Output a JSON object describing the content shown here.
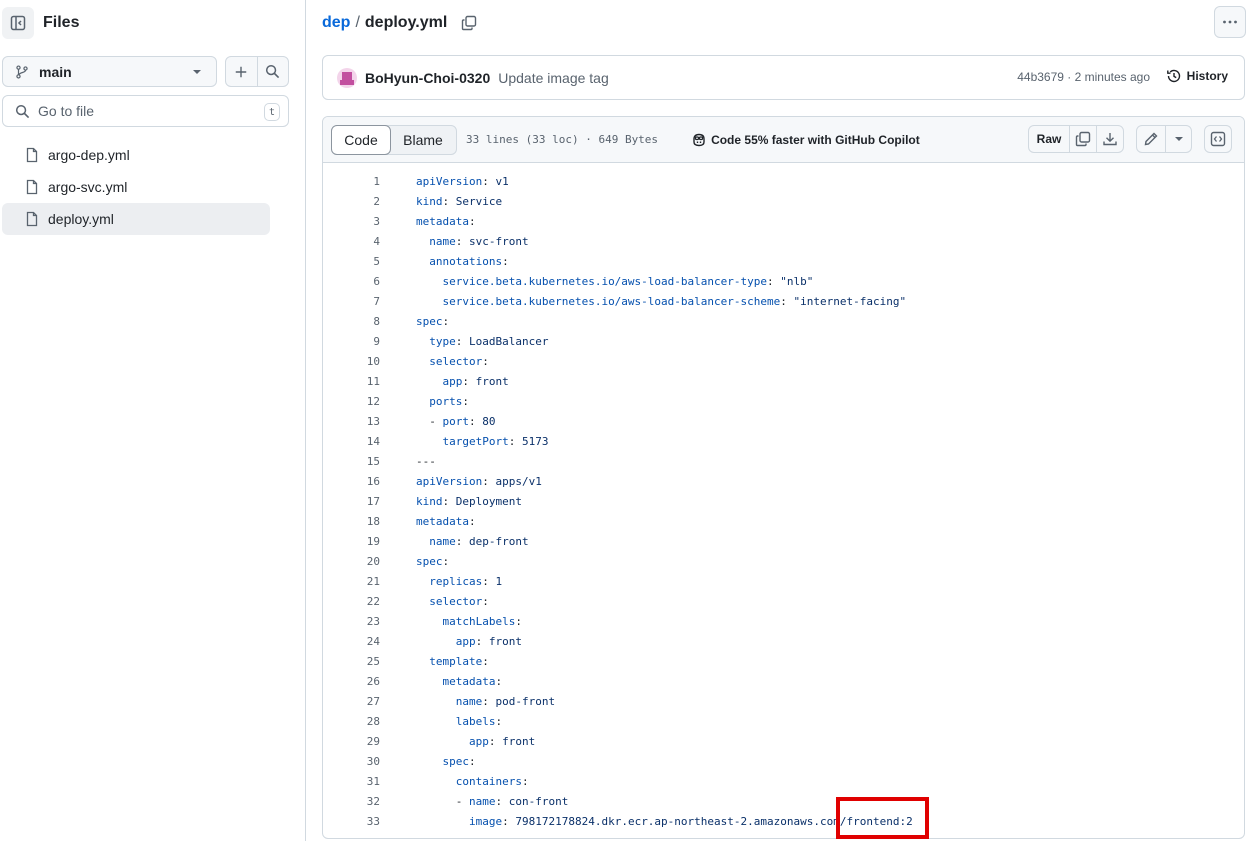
{
  "sidebar": {
    "title": "Files",
    "branch": "main",
    "search_placeholder": "Go to file",
    "search_shortcut": "t",
    "files": [
      {
        "name": "argo-dep.yml",
        "active": false
      },
      {
        "name": "argo-svc.yml",
        "active": false
      },
      {
        "name": "deploy.yml",
        "active": true
      }
    ]
  },
  "breadcrumb": {
    "repo": "dep",
    "separator": "/",
    "file": "deploy.yml"
  },
  "commit": {
    "author": "BoHyun-Choi-0320",
    "message": "Update image tag",
    "meta": "44b3679 · 2 minutes ago",
    "history_label": "History"
  },
  "file_header": {
    "code_tab": "Code",
    "blame_tab": "Blame",
    "info": "33 lines (33 loc) · 649 Bytes",
    "copilot": "Code 55% faster with GitHub Copilot",
    "raw_label": "Raw"
  },
  "code_lines": [
    {
      "n": "1",
      "key": "apiVersion",
      "val": "v1"
    },
    {
      "n": "2",
      "key": "kind",
      "val": "Service"
    },
    {
      "n": "3",
      "key": "metadata",
      "val": ""
    },
    {
      "n": "4",
      "key": "  name",
      "val": "svc-front"
    },
    {
      "n": "5",
      "key": "  annotations",
      "val": ""
    },
    {
      "n": "6",
      "key": "    service.beta.kubernetes.io/aws-load-balancer-type",
      "val": "\"nlb\""
    },
    {
      "n": "7",
      "key": "    service.beta.kubernetes.io/aws-load-balancer-scheme",
      "val": "\"internet-facing\""
    },
    {
      "n": "8",
      "key": "spec",
      "val": ""
    },
    {
      "n": "9",
      "key": "  type",
      "val": "LoadBalancer"
    },
    {
      "n": "10",
      "key": "  selector",
      "val": ""
    },
    {
      "n": "11",
      "key": "    app",
      "val": "front"
    },
    {
      "n": "12",
      "key": "  ports",
      "val": ""
    },
    {
      "n": "13",
      "key": "  - port",
      "val": "80"
    },
    {
      "n": "14",
      "key": "    targetPort",
      "val": "5173"
    },
    {
      "n": "15",
      "key": "---",
      "val": null
    },
    {
      "n": "16",
      "key": "apiVersion",
      "val": "apps/v1"
    },
    {
      "n": "17",
      "key": "kind",
      "val": "Deployment"
    },
    {
      "n": "18",
      "key": "metadata",
      "val": ""
    },
    {
      "n": "19",
      "key": "  name",
      "val": "dep-front"
    },
    {
      "n": "20",
      "key": "spec",
      "val": ""
    },
    {
      "n": "21",
      "key": "  replicas",
      "val": "1"
    },
    {
      "n": "22",
      "key": "  selector",
      "val": ""
    },
    {
      "n": "23",
      "key": "    matchLabels",
      "val": ""
    },
    {
      "n": "24",
      "key": "      app",
      "val": "front"
    },
    {
      "n": "25",
      "key": "  template",
      "val": ""
    },
    {
      "n": "26",
      "key": "    metadata",
      "val": ""
    },
    {
      "n": "27",
      "key": "      name",
      "val": "pod-front"
    },
    {
      "n": "28",
      "key": "      labels",
      "val": ""
    },
    {
      "n": "29",
      "key": "        app",
      "val": "front"
    },
    {
      "n": "30",
      "key": "    spec",
      "val": ""
    },
    {
      "n": "31",
      "key": "      containers",
      "val": ""
    },
    {
      "n": "32",
      "key": "      - name",
      "val": "con-front"
    },
    {
      "n": "33",
      "key": "        image",
      "val": "798172178824.dkr.ecr.ap-northeast-2.amazonaws.com/frontend:2"
    }
  ],
  "colors": {
    "link": "#0969da",
    "yaml_key": "#0550ae",
    "annotation_box": "#e00000"
  }
}
